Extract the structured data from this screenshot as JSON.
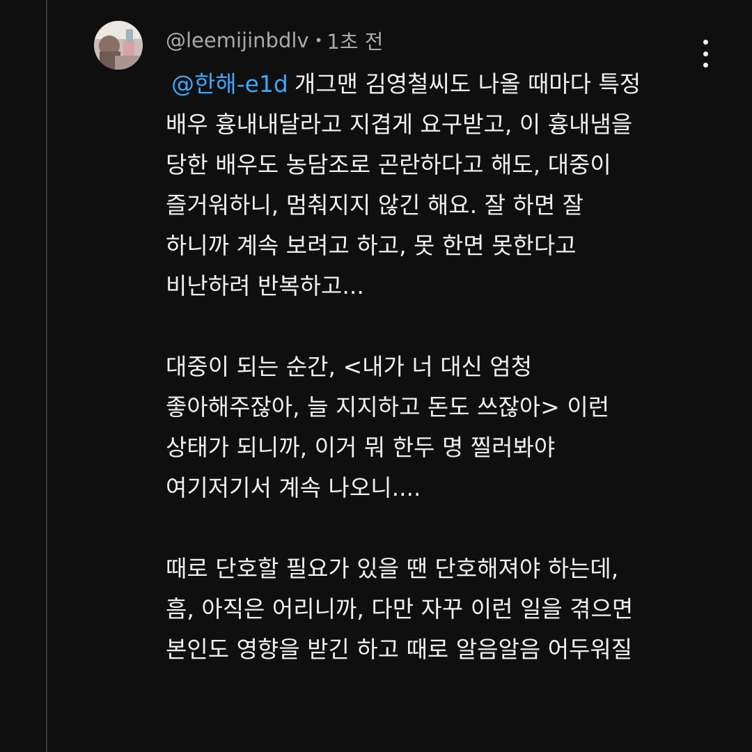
{
  "comment": {
    "author": "@leemijinbdlv",
    "separator": "•",
    "time": "1초 전",
    "mention": "@한해-e1d",
    "lines": [
      "개그맨 김영철씨도 나올 때마다 특정",
      "배우 흉내내달라고 지겹게 요구받고, 이 흉내냄을",
      "당한 배우도 농담조로 곤란하다고 해도, 대중이",
      "즐거워하니, 멈춰지지 않긴 해요. 잘 하면 잘",
      "하니까 계속 보려고 하고, 못 한면 못한다고",
      "비난하려 반복하고...",
      "",
      "대중이 되는 순간, <내가 너 대신 엄청",
      "좋아해주잖아, 늘 지지하고 돈도 쓰잖아> 이런",
      "상태가 되니까, 이거 뭐 한두 명 찔러봐야",
      "여기저기서 계속 나오니....",
      "",
      "때로 단호할 필요가 있을 땐 단호해져야 하는데,",
      "흠, 아직은 어리니까, 다만 자꾸 이런 일을 겪으면",
      "본인도 영향을 받긴 하고 때로 알음알음 어두워질"
    ]
  },
  "icons": {
    "avatar": "user-avatar-photo",
    "more": "more-vertical-icon"
  },
  "colors": {
    "background": "#0f0f0f",
    "text": "#f1f1f1",
    "meta": "#aaaaaa",
    "mention": "#3ea6ff"
  }
}
